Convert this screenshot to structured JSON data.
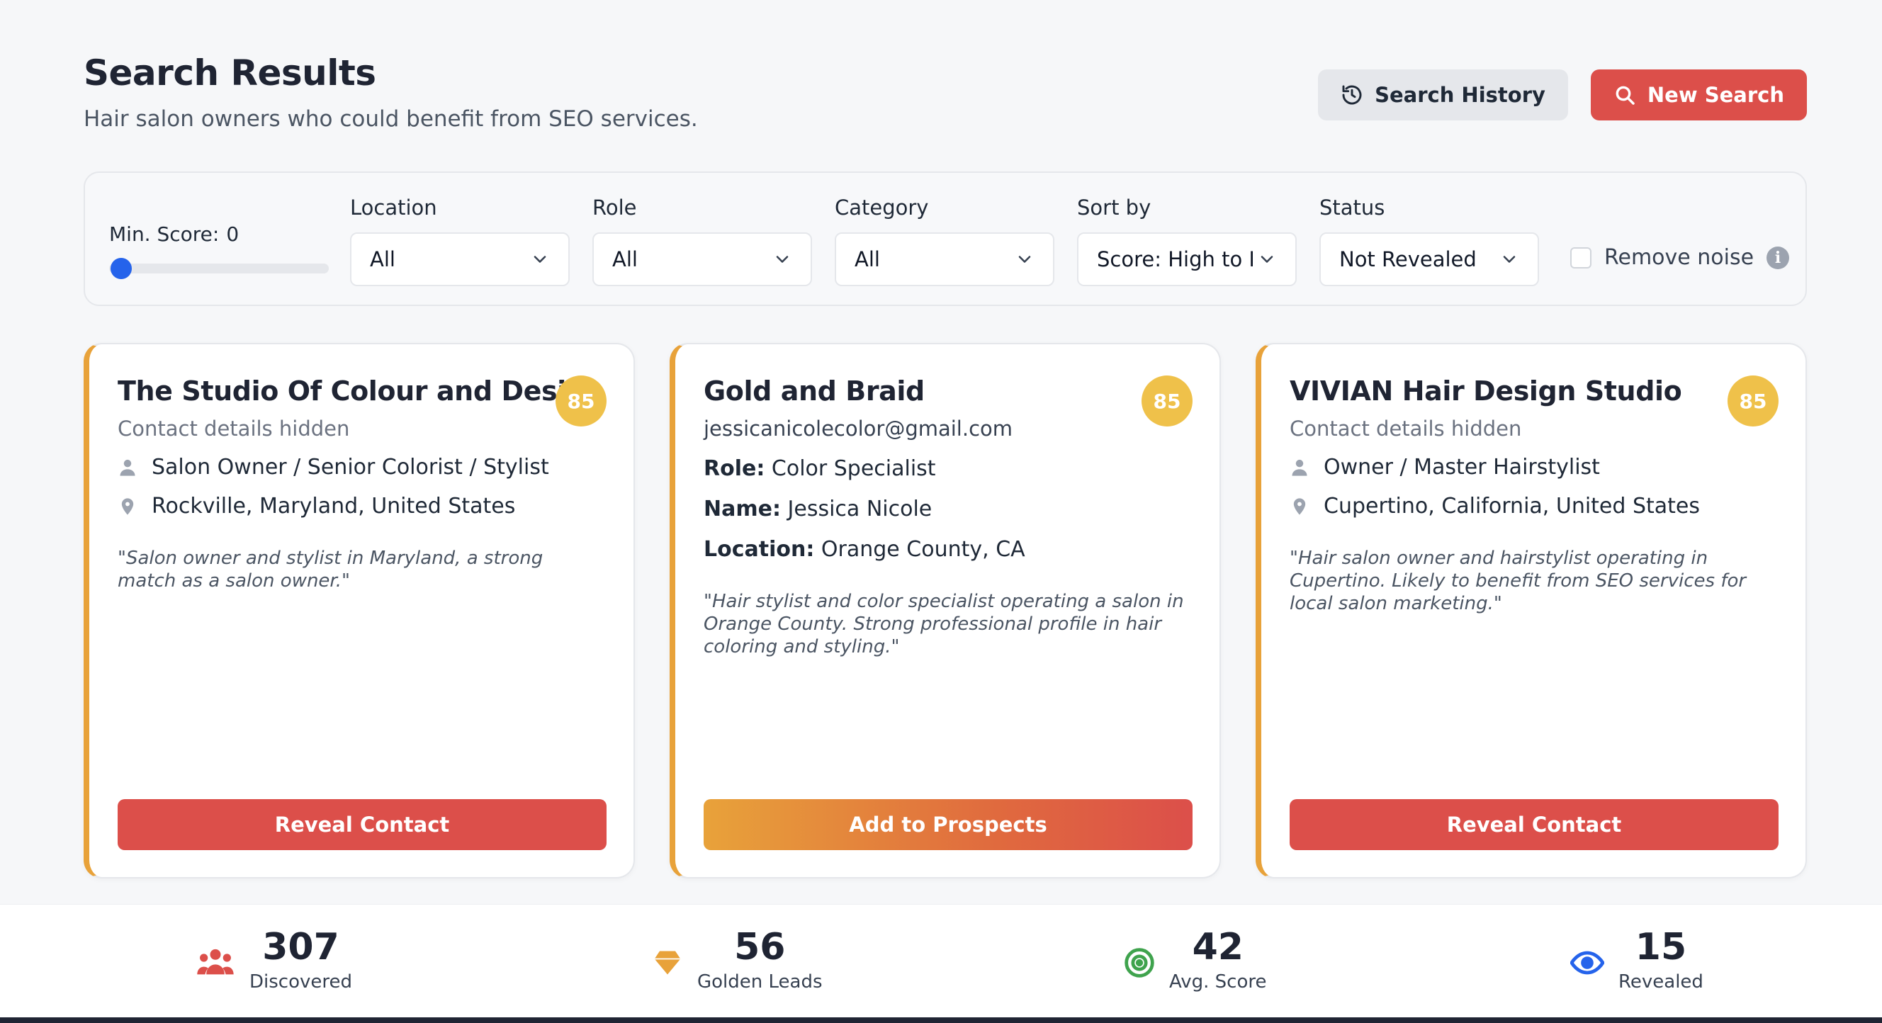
{
  "header": {
    "title": "Search Results",
    "subtitle": "Hair salon owners who could benefit from SEO services.",
    "history_label": "Search History",
    "new_search_label": "New Search"
  },
  "filters": {
    "min_score_label": "Min. Score:",
    "min_score_value": "0",
    "min_score_fraction": 0,
    "location": {
      "label": "Location",
      "value": "All"
    },
    "role": {
      "label": "Role",
      "value": "All"
    },
    "category": {
      "label": "Category",
      "value": "All"
    },
    "sort": {
      "label": "Sort by",
      "value": "Score: High to L"
    },
    "status": {
      "label": "Status",
      "value": "Not Revealed"
    },
    "remove_noise_label": "Remove noise",
    "remove_noise_checked": false
  },
  "cards": [
    {
      "title": "The Studio Of Colour and Design",
      "score": "85",
      "subtitle": "Contact details hidden",
      "role": "Salon Owner / Senior Colorist / Stylist",
      "location": "Rockville, Maryland, United States",
      "quote": "\"Salon owner and stylist in Maryland, a strong match as a salon owner.\"",
      "button": "Reveal Contact"
    },
    {
      "title": "Gold and Braid",
      "score": "85",
      "subtitle": "jessicanicolecolor@gmail.com",
      "role_key": "Role:",
      "role_value": "Color Specialist",
      "name_key": "Name:",
      "name_value": "Jessica Nicole",
      "location_key": "Location:",
      "location_value": "Orange County, CA",
      "quote": "\"Hair stylist and color specialist operating a salon in Orange County. Strong professional profile in hair coloring and styling.\"",
      "button": "Add to Prospects"
    },
    {
      "title": "VIVIAN Hair Design Studio",
      "score": "85",
      "subtitle": "Contact details hidden",
      "role": "Owner / Master Hairstylist",
      "location": "Cupertino, California, United States",
      "quote": "\"Hair salon owner and hairstylist operating in Cupertino. Likely to benefit from SEO services for local salon marketing.\"",
      "button": "Reveal Contact"
    }
  ],
  "stats": [
    {
      "value": "307",
      "label": "Discovered",
      "icon": "users-icon",
      "color": "#dc4f4a"
    },
    {
      "value": "56",
      "label": "Golden Leads",
      "icon": "diamond-icon",
      "color": "#e8a23a"
    },
    {
      "value": "42",
      "label": "Avg. Score",
      "icon": "target-icon",
      "color": "#3fa34d"
    },
    {
      "value": "15",
      "label": "Revealed",
      "icon": "eye-icon",
      "color": "#2563eb"
    }
  ],
  "colors": {
    "accent_red": "#dc4f4a",
    "card_accent": "#e8a23a",
    "score_badge": "#efc14a",
    "slider": "#2563eb"
  }
}
